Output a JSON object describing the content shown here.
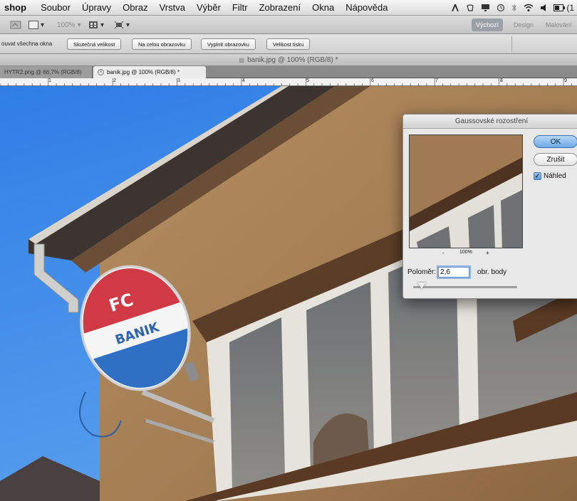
{
  "menu": {
    "app_name": "shop",
    "items": [
      "Soubor",
      "Úpravy",
      "Obraz",
      "Vrstva",
      "Výběr",
      "Filtr",
      "Zobrazení",
      "Okna",
      "Nápověda"
    ],
    "battery_text": "(1"
  },
  "appbar": {
    "zoom_value": "100%",
    "workspaces": [
      "Výchozí",
      "Design",
      "Malování"
    ]
  },
  "options": {
    "scroll_all_label": "ouvat všechna okna",
    "buttons": [
      "Skutečná velikost",
      "Na celou obrazovku",
      "Vyplnit obrazovku",
      "Velikost tisku"
    ]
  },
  "document": {
    "title": "banik.jpg @ 100% (RGB/8) *",
    "tabs": [
      {
        "label": "HYTR2.png @ 66,7% (RGB/8)",
        "active": false
      },
      {
        "label": "banik.jpg @ 100% (RGB/8) *",
        "active": true
      }
    ]
  },
  "ruler": {
    "labels": [
      "1",
      "2",
      "3",
      "4",
      "5",
      "6",
      "7",
      "8",
      "9"
    ]
  },
  "sign": {
    "line1": "FC",
    "line2": "BANIK"
  },
  "dialog": {
    "title": "Gaussovské rozostření",
    "ok_label": "OK",
    "cancel_label": "Zrušit",
    "preview_label": "Náhled",
    "preview_checked": true,
    "zoom_out": "-",
    "zoom_level": "100%",
    "zoom_in": "+",
    "radius_label": "Poloměr:",
    "radius_value": "2,6",
    "radius_unit": "obr. body",
    "radius_slider_fraction": 0.08
  }
}
